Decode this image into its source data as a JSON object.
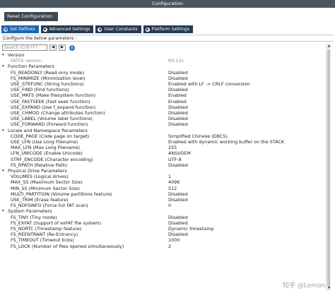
{
  "window": {
    "title": "Configuration"
  },
  "toolbar": {
    "reset_label": "Reset Configuration"
  },
  "tabs": [
    {
      "label": "Set Defines",
      "active": true
    },
    {
      "label": "Advanced Settings",
      "active": false
    },
    {
      "label": "User Constants",
      "active": false
    },
    {
      "label": "Platform Settings",
      "active": false
    }
  ],
  "instruction": "Configure the below parameters :",
  "search": {
    "placeholder": "Search (Crtl+F)",
    "prev": "◀",
    "next": "▶",
    "info": "i"
  },
  "tree": [
    {
      "kind": "cat",
      "label": "Version"
    },
    {
      "kind": "param",
      "label": "FATFS version",
      "value": "R0.12c",
      "grey": true
    },
    {
      "kind": "cat",
      "label": "Function Parameters"
    },
    {
      "kind": "param",
      "label": "FS_READONLY (Read-only mode)",
      "value": "Disabled"
    },
    {
      "kind": "param",
      "label": "FS_MINIMIZE (Minimization level)",
      "value": "Disabled"
    },
    {
      "kind": "param",
      "label": "USE_STRFUNC (String functions)",
      "value": "Enabled with LF -> CRLF conversion"
    },
    {
      "kind": "param",
      "label": "USE_FIND (Find functions)",
      "value": "Disabled"
    },
    {
      "kind": "param",
      "label": "USE_MKFS (Make filesystem function)",
      "value": "Enabled"
    },
    {
      "kind": "param",
      "label": "USE_FASTSEEK (Fast seek function)",
      "value": "Enabled"
    },
    {
      "kind": "param",
      "label": "USE_EXPAND (Use f_expand function)",
      "value": "Disabled"
    },
    {
      "kind": "param",
      "label": "USE_CHMOD (Change attributes function)",
      "value": "Disabled"
    },
    {
      "kind": "param",
      "label": "USE_LABEL (Volume label functions)",
      "value": "Disabled"
    },
    {
      "kind": "param",
      "label": "USE_FORWARD (Forward function)",
      "value": "Disabled"
    },
    {
      "kind": "cat",
      "label": "Locale and Namespace Parameters"
    },
    {
      "kind": "param",
      "label": "CODE_PAGE (Code page on target)",
      "value": "Simplified Chinese (DBCS)"
    },
    {
      "kind": "param",
      "label": "USE_LFN (Use Long Filename)",
      "value": "Enabled with dynamic working buffer on the STACK"
    },
    {
      "kind": "param",
      "label": "MAX_LFN (Max Long Filename)",
      "value": "255"
    },
    {
      "kind": "param",
      "label": "LFN_UNICODE (Enable Unicode)",
      "value": "ANSI/OEM"
    },
    {
      "kind": "param",
      "label": "STRF_ENCODE (Character encoding)",
      "value": "UTF-8"
    },
    {
      "kind": "param",
      "label": "FS_RPATH (Relative Path)",
      "value": "Disabled"
    },
    {
      "kind": "cat",
      "label": "Physical Drive Parameters"
    },
    {
      "kind": "param",
      "label": "VOLUMES (Logical drives)",
      "value": "1"
    },
    {
      "kind": "param",
      "label": "MAX_SS (Maximum Sector Size)",
      "value": "4096"
    },
    {
      "kind": "param",
      "label": "MIN_SS (Minimum Sector Size)",
      "value": "512"
    },
    {
      "kind": "param",
      "label": "MULTI_PARTITION (Volume partitions feature)",
      "value": "Disabled"
    },
    {
      "kind": "param",
      "label": "USE_TRIM (Erase feature)",
      "value": "Disabled"
    },
    {
      "kind": "param",
      "label": "FS_NOFSINFO (Force full FAT scan)",
      "value": "0"
    },
    {
      "kind": "cat",
      "label": "System Parameters"
    },
    {
      "kind": "param",
      "label": "FS_TINY (Tiny mode)",
      "value": "Disabled"
    },
    {
      "kind": "param",
      "label": "FS_EXFAT (Support of exFAT file system)",
      "value": "Disabled"
    },
    {
      "kind": "param",
      "label": "FS_NORTC (Timestamp feature)",
      "value": "Dynamic timestamp"
    },
    {
      "kind": "param",
      "label": "FS_REENTRANT (Re-Entrancy)",
      "value": "Disabled"
    },
    {
      "kind": "param",
      "label": "FS_TIMEOUT (Timeout ticks)",
      "value": "1000"
    },
    {
      "kind": "param",
      "label": "FS_LOCK (Number of files opened simultaneously)",
      "value": "2"
    }
  ],
  "scrollbar": {
    "up": "▲",
    "down": "▼"
  },
  "watermark": "知乎 @Lemon"
}
